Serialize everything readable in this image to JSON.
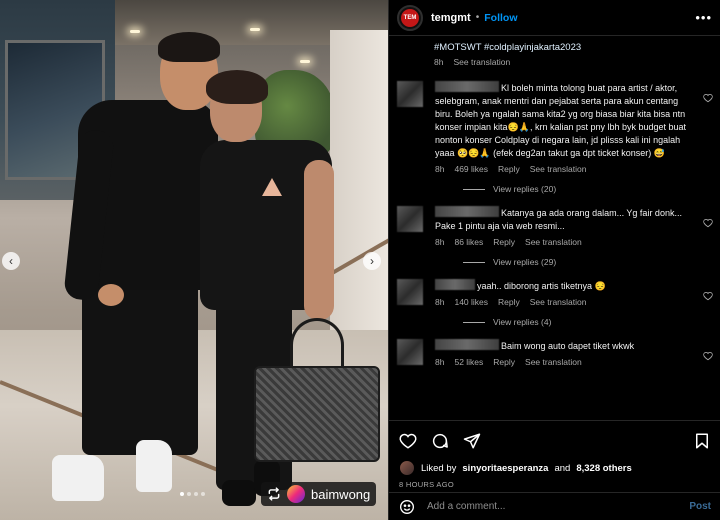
{
  "post": {
    "username": "temgmt",
    "avatar_text": "TEM",
    "follow_label": "Follow",
    "more_label": "•••",
    "repost_username": "baimwong"
  },
  "caption": {
    "tags": "#MOTSWT #coldplayinjakarta2023",
    "time": "8h",
    "see_translation": "See translation"
  },
  "comments": [
    {
      "text": "Kl boleh minta tolong buat para artist / aktor, selebgram, anak mentri dan pejabat serta para akun centang biru. Boleh ya ngalah sama kita2 yg org biasa biar kita bisa ntn konser impian kita😔🙏, krn kalian pst pny lbh byk budget buat nonton konser Coldplay di negara lain, jd plisss kali ini ngalah yaaa 🥺😔🙏 (efek deg2an takut ga dpt ticket konser) 😅",
      "time": "8h",
      "likes": "469 likes",
      "reply": "Reply",
      "translation": "See translation",
      "view_replies": "View replies (20)"
    },
    {
      "text": "Katanya ga ada orang dalam... Yg fair donk... Pake 1 pintu aja via web resmi...",
      "time": "8h",
      "likes": "86 likes",
      "reply": "Reply",
      "translation": "See translation",
      "view_replies": "View replies (29)"
    },
    {
      "text": "yaah.. diborong artis tiketnya 😔",
      "time": "8h",
      "likes": "140 likes",
      "reply": "Reply",
      "translation": "See translation",
      "view_replies": "View replies (4)"
    },
    {
      "text": "Baim wong auto dapet tiket wkwk",
      "time": "8h",
      "likes": "52 likes",
      "reply": "Reply",
      "translation": "See translation",
      "view_replies": ""
    }
  ],
  "likes": {
    "prefix": "Liked by",
    "user": "sinyoritaesperanza",
    "and": "and",
    "count": "8,328 others"
  },
  "time_ago": "8 HOURS AGO",
  "add_comment": {
    "placeholder": "Add a comment...",
    "post_label": "Post"
  },
  "icons": {
    "like": "heart-icon",
    "comment": "comment-icon",
    "share": "share-icon",
    "save": "bookmark-icon",
    "emoji": "emoji-icon",
    "repost": "repost-icon"
  }
}
